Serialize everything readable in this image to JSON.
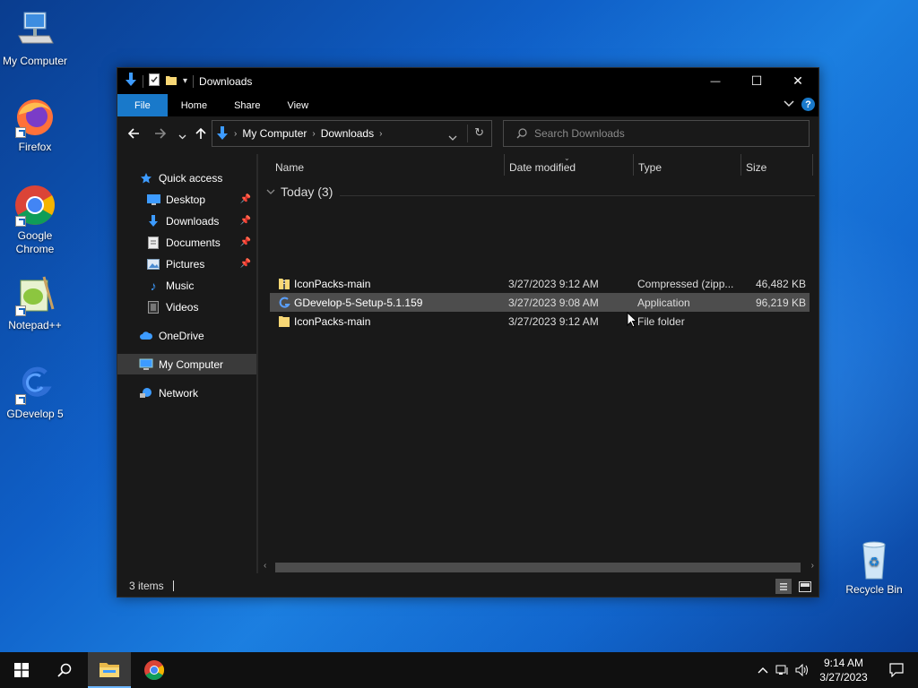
{
  "desktop": {
    "icons": [
      {
        "label": "My Computer"
      },
      {
        "label": "Firefox"
      },
      {
        "label": "Google\nChrome"
      },
      {
        "label": "Notepad++"
      },
      {
        "label": "GDevelop 5"
      },
      {
        "label": "Recycle Bin"
      }
    ]
  },
  "window": {
    "title": "Downloads",
    "controls": {
      "minimize": "—",
      "maximize": "☐",
      "close": "✕"
    },
    "ribbon": {
      "tabs": [
        "File",
        "Home",
        "Share",
        "View"
      ],
      "help": "?"
    },
    "address": {
      "crumbs": [
        "My Computer",
        "Downloads"
      ]
    },
    "search": {
      "placeholder": "Search Downloads"
    },
    "navpane": {
      "items": [
        {
          "label": "Quick access",
          "icon": "star-icon"
        },
        {
          "label": "Desktop",
          "icon": "desktop-folder-icon",
          "pinned": true
        },
        {
          "label": "Downloads",
          "icon": "download-folder-icon",
          "pinned": true
        },
        {
          "label": "Documents",
          "icon": "documents-folder-icon",
          "pinned": true
        },
        {
          "label": "Pictures",
          "icon": "pictures-folder-icon",
          "pinned": true
        },
        {
          "label": "Music",
          "icon": "music-folder-icon"
        },
        {
          "label": "Videos",
          "icon": "videos-folder-icon"
        },
        {
          "label": "OneDrive",
          "icon": "cloud-icon"
        },
        {
          "label": "My Computer",
          "icon": "computer-icon",
          "selected": true
        },
        {
          "label": "Network",
          "icon": "network-icon"
        }
      ]
    },
    "columns": [
      "Name",
      "Date modified",
      "Type",
      "Size"
    ],
    "group": "Today (3)",
    "files": [
      {
        "name": "IconPacks-main",
        "date": "3/27/2023 9:12 AM",
        "type": "Compressed (zipp...",
        "size": "46,482 KB",
        "icon": "zip-folder-icon"
      },
      {
        "name": "GDevelop-5-Setup-5.1.159",
        "date": "3/27/2023 9:08 AM",
        "type": "Application",
        "size": "96,219 KB",
        "icon": "gdevelop-app-icon",
        "hover": true
      },
      {
        "name": "IconPacks-main",
        "date": "3/27/2023 9:12 AM",
        "type": "File folder",
        "size": "",
        "icon": "folder-icon"
      }
    ],
    "status": {
      "items": "3 items"
    }
  },
  "taskbar": {
    "clock": {
      "time": "9:14 AM",
      "date": "3/27/2023"
    }
  },
  "colors": {
    "accent": "#1979ca",
    "window_bg": "#191919",
    "titlebar_bg": "#000000",
    "taskbar_bg": "#101010"
  }
}
